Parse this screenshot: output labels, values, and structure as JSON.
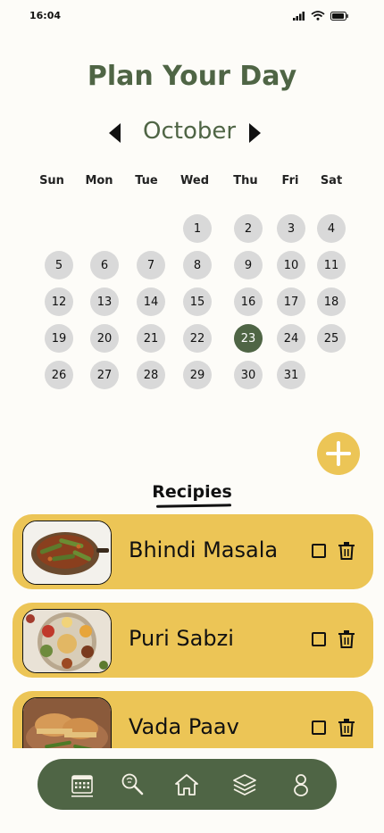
{
  "status": {
    "time": "16:04"
  },
  "title": "Plan Your Day",
  "calendar": {
    "month": "October",
    "weekdays": [
      "Sun",
      "Mon",
      "Tue",
      "Wed",
      "Thu",
      "Fri",
      "Sat"
    ],
    "first_weekday_index": 3,
    "days_in_month": 31,
    "selected_day": 23
  },
  "recipes_section": {
    "title": "Recipies"
  },
  "recipes": [
    {
      "name": "Bhindi Masala"
    },
    {
      "name": "Puri Sabzi"
    },
    {
      "name": "Vada Paav"
    }
  ],
  "bottom_nav": {
    "items": [
      {
        "icon": "calendar-icon",
        "active": true
      },
      {
        "icon": "recipe-search-icon",
        "active": false
      },
      {
        "icon": "home-icon",
        "active": false
      },
      {
        "icon": "layers-icon",
        "active": false
      },
      {
        "icon": "profile-icon",
        "active": false
      }
    ]
  },
  "colors": {
    "accent_green": "#4f6545",
    "card_yellow": "#ecc556",
    "day_grey": "#d9d9d9",
    "background": "#fdfcf8"
  }
}
